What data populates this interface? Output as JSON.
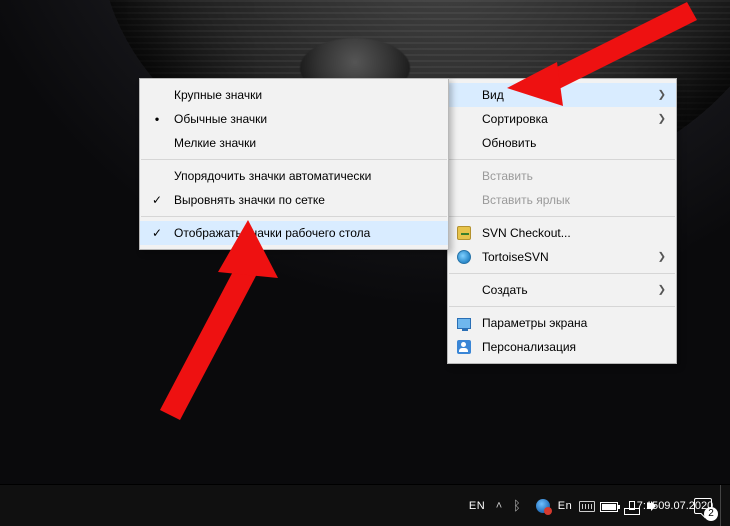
{
  "main_menu": {
    "vid": {
      "label": "Вид",
      "has_sub": true,
      "hover": true
    },
    "sort": {
      "label": "Сортировка",
      "has_sub": true
    },
    "refresh": {
      "label": "Обновить"
    },
    "paste": {
      "label": "Вставить",
      "disabled": true
    },
    "paste_link": {
      "label": "Вставить ярлык",
      "disabled": true
    },
    "svn": {
      "label": "SVN Checkout..."
    },
    "tortoise": {
      "label": "TortoiseSVN",
      "has_sub": true
    },
    "create": {
      "label": "Создать",
      "has_sub": true
    },
    "display": {
      "label": "Параметры экрана"
    },
    "personal": {
      "label": "Персонализация"
    }
  },
  "view_submenu": {
    "large": {
      "label": "Крупные значки"
    },
    "medium": {
      "label": "Обычные значки",
      "selected": true
    },
    "small": {
      "label": "Мелкие значки"
    },
    "auto": {
      "label": "Упорядочить значки автоматически"
    },
    "grid": {
      "label": "Выровнять значки по сетке",
      "checked": true
    },
    "show": {
      "label": "Отображать значки рабочего стола",
      "checked": true,
      "hover": true
    }
  },
  "taskbar": {
    "lang_short": "EN",
    "lang_input": "En",
    "time": "7:15",
    "date": "09.07.2020",
    "notifications": "2",
    "tray_up_glyph": "˄"
  },
  "icons": {
    "chevron": "❯",
    "check": "✓",
    "bullet": "●",
    "bluetooth": "ᛒ"
  }
}
